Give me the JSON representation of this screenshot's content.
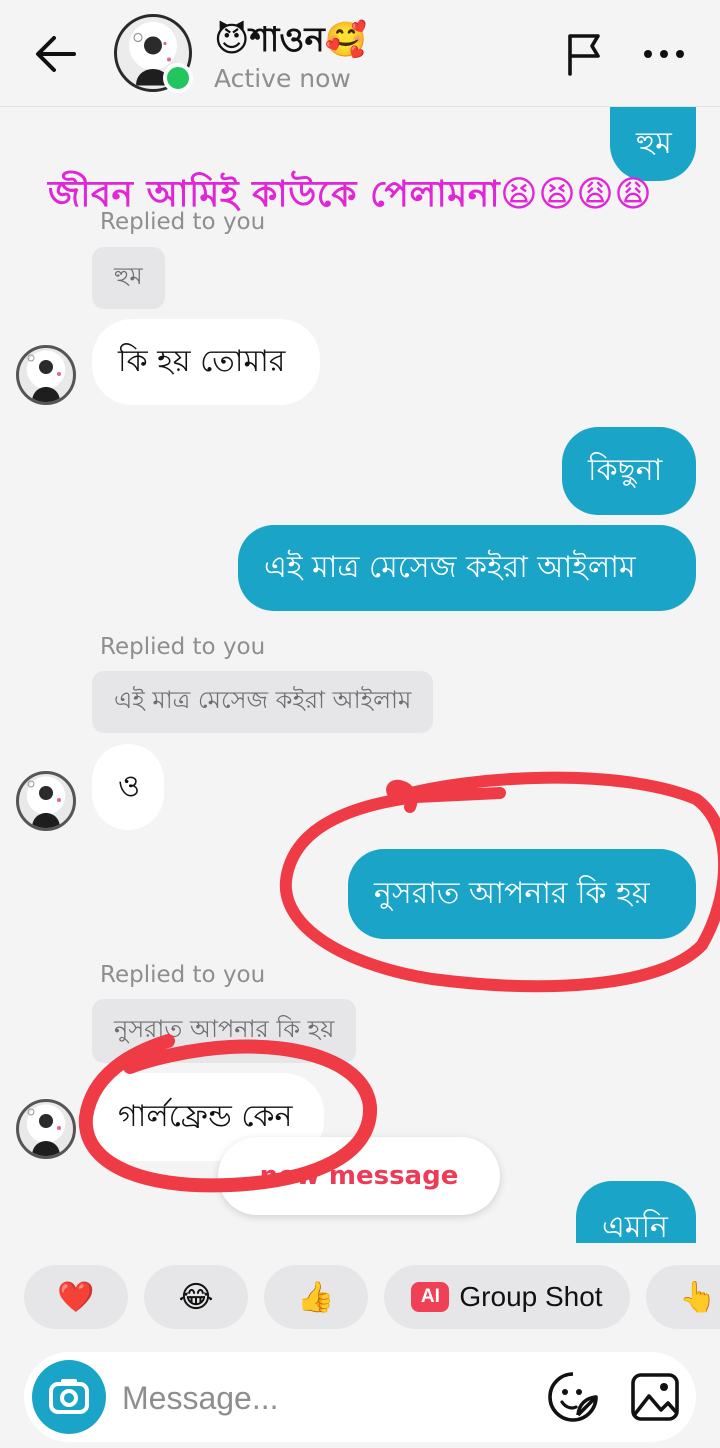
{
  "header": {
    "contact_name": "😈শাওন🥰",
    "status": "Active now",
    "icons": {
      "back": "back-arrow-icon",
      "flag": "flag-icon",
      "more": "more-horizontal-icon"
    }
  },
  "overlay_text": "জীবন আমিই কাউকে পেলামনা😫😫😩😩",
  "messages": [
    {
      "id": "m1",
      "direction": "outgoing",
      "text": "হুম"
    },
    {
      "id": "m2",
      "direction": "incoming",
      "replied_label": "Replied to you",
      "quoted": "হুম",
      "text": "কি হয় তোমার"
    },
    {
      "id": "m3",
      "direction": "outgoing",
      "text": "কিছুনা"
    },
    {
      "id": "m4",
      "direction": "outgoing",
      "text": "এই মাত্র  মেসেজ কইরা আইলাম"
    },
    {
      "id": "m5",
      "direction": "incoming",
      "replied_label": "Replied to you",
      "quoted": "এই মাত্র  মেসেজ কইরা আইলাম",
      "text": "ও"
    },
    {
      "id": "m6",
      "direction": "outgoing",
      "text": "নুসরাত আপনার কি হয়"
    },
    {
      "id": "m7",
      "direction": "incoming",
      "replied_label": "Replied to you",
      "quoted": "নুসরাত আপনার কি হয়",
      "text": "গার্লফ্রেন্ড কেন"
    },
    {
      "id": "m8",
      "direction": "outgoing",
      "text": "এমনি"
    }
  ],
  "new_message_pill": "new message",
  "quick_reactions": [
    {
      "emoji": "❤️",
      "name": "heart-emoji"
    },
    {
      "emoji": "😂",
      "name": "joy-emoji"
    },
    {
      "emoji": "👍",
      "name": "thumbs-up-emoji"
    },
    {
      "badge": "AI",
      "label": "Group Shot",
      "name": "group-shot-chip"
    },
    {
      "emoji": "👆",
      "name": "pointing-up-emoji"
    }
  ],
  "composer": {
    "placeholder": "Message...",
    "icons": {
      "camera": "camera-icon",
      "sticker": "sticker-icon",
      "gallery": "gallery-icon"
    }
  },
  "colors": {
    "outgoing_bubble": "#1aa5c8",
    "incoming_bubble": "#ffffff",
    "background": "#f4f4f5",
    "online": "#22c55e",
    "overlay_text": "#e026d6",
    "annotation": "#ef3b46",
    "new_message": "#ed3b57"
  }
}
